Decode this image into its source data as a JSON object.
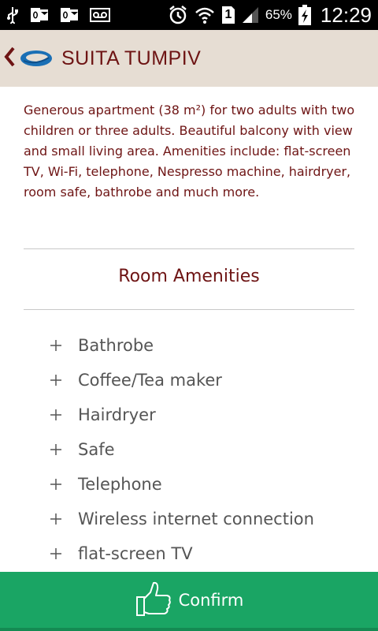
{
  "status_bar": {
    "battery_percent": "65%",
    "time": "12:29",
    "sim_slot": "1",
    "icons": [
      "usb-icon",
      "outlook-icon",
      "outlook-icon",
      "voicemail-icon",
      "alarm-icon",
      "wifi-icon",
      "sim-1-icon",
      "signal-icon",
      "battery-charging-icon"
    ]
  },
  "header": {
    "title": "SUITA TUMPIV",
    "background_color": "#e6ddd3",
    "title_color": "#6e1414"
  },
  "description": "Generous apartment (38 m²) for two adults with two children or three adults. Beautiful balcony with view and small living area. Amenities include: flat-screen TV, Wi-Fi, telephone, Nespresso machine, hairdryer, room safe, bathrobe and much more.",
  "amenities_section": {
    "title": "Room Amenities",
    "items": [
      {
        "label": "Bathrobe"
      },
      {
        "label": "Coffee/Tea maker"
      },
      {
        "label": "Hairdryer"
      },
      {
        "label": "Safe"
      },
      {
        "label": "Telephone"
      },
      {
        "label": "Wireless internet connection"
      },
      {
        "label": "flat-screen TV"
      }
    ]
  },
  "confirm": {
    "label": "Confirm",
    "background_color": "#1aa564"
  }
}
